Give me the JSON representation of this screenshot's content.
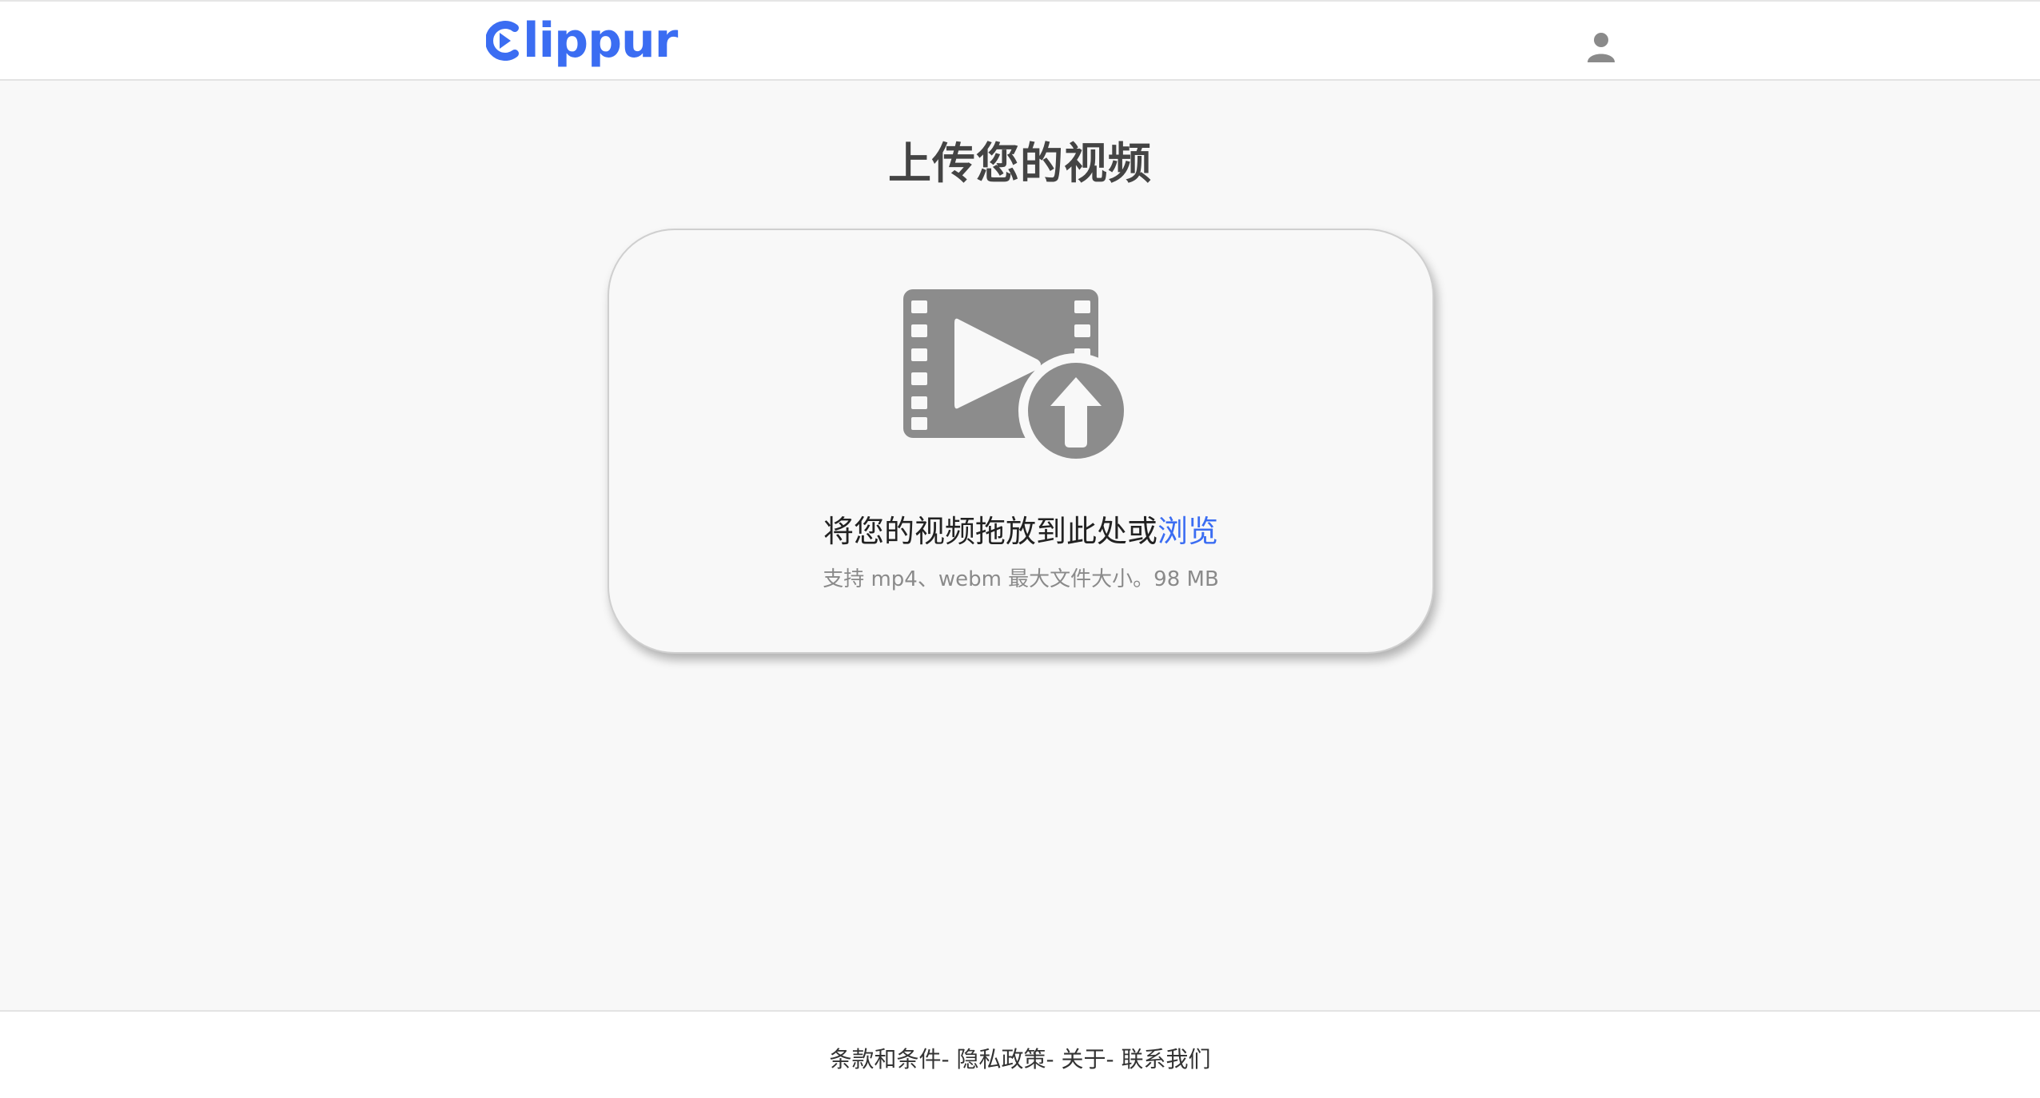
{
  "header": {
    "logo_text": "lippur",
    "logo_color": "#3b6df2",
    "account_icon": "user-icon"
  },
  "main": {
    "title": "上传您的视频",
    "dropzone": {
      "icon": "video-upload-icon",
      "drop_text": "将您的视频拖放到此处或",
      "browse_label": "浏览",
      "hint": "支持 mp4、webm  最大文件大小。98 MB"
    }
  },
  "footer": {
    "links": [
      {
        "label": "条款和条件"
      },
      {
        "label": "隐私政策"
      },
      {
        "label": "关于"
      },
      {
        "label": "联系我们"
      }
    ],
    "separator": "- "
  },
  "colors": {
    "accent": "#3b6df2",
    "icon_gray": "#8c8c8c",
    "background": "#f8f8f8"
  }
}
